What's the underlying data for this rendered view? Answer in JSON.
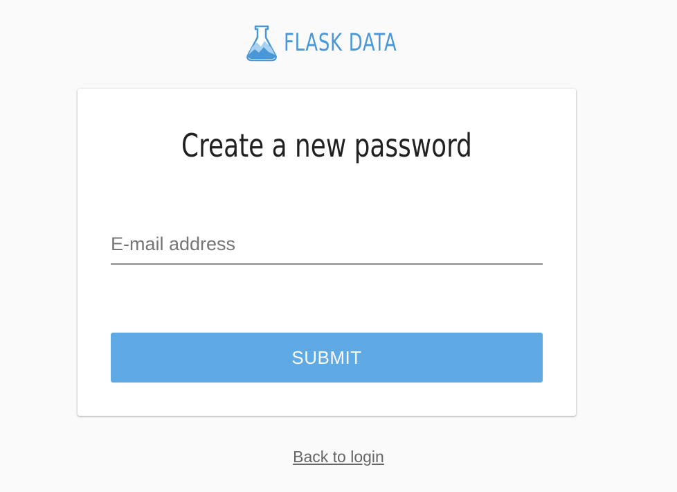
{
  "brand": {
    "name": "FLASK DATA",
    "icon": "flask-icon",
    "color": "#4a97d8"
  },
  "form": {
    "title": "Create a new password",
    "email": {
      "value": "",
      "placeholder": "E-mail address"
    },
    "submit_label": "SUBMIT",
    "submit_color": "#5fa9e4"
  },
  "footer": {
    "back_link_label": "Back to login"
  }
}
